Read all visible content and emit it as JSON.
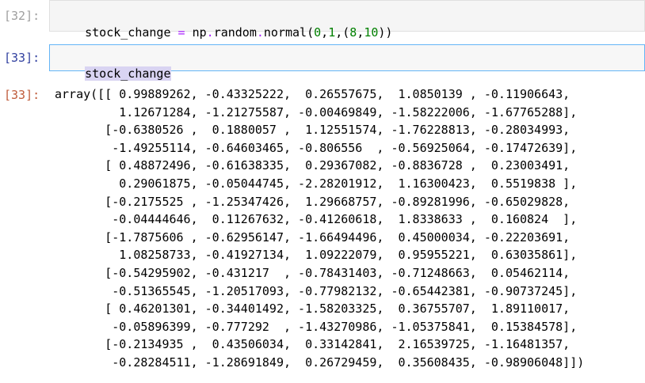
{
  "cells": [
    {
      "prompt": "[32]:",
      "code_tokens": [
        {
          "t": "stock_change",
          "k": "name"
        },
        {
          "t": " ",
          "k": "name"
        },
        {
          "t": "=",
          "k": "op"
        },
        {
          "t": " np",
          "k": "name"
        },
        {
          "t": ".",
          "k": "op"
        },
        {
          "t": "random",
          "k": "name"
        },
        {
          "t": ".",
          "k": "op"
        },
        {
          "t": "normal",
          "k": "name"
        },
        {
          "t": "(",
          "k": "paren"
        },
        {
          "t": "0",
          "k": "num"
        },
        {
          "t": ",",
          "k": "paren"
        },
        {
          "t": "1",
          "k": "num"
        },
        {
          "t": ",(",
          "k": "paren"
        },
        {
          "t": "8",
          "k": "num"
        },
        {
          "t": ",",
          "k": "paren"
        },
        {
          "t": "10",
          "k": "num"
        },
        {
          "t": "))",
          "k": "paren"
        }
      ]
    },
    {
      "prompt": "[33]:",
      "code": "stock_change"
    }
  ],
  "output": {
    "prompt": "[33]:",
    "lines": [
      "array([[ 0.99889262, -0.43325222,  0.26557675,  1.0850139 , -0.11906643,",
      "         1.12671284, -1.21275587, -0.00469849, -1.58222006, -1.67765288],",
      "       [-0.6380526 ,  0.1880057 ,  1.12551574, -1.76228813, -0.28034993,",
      "        -1.49255114, -0.64603465, -0.806556  , -0.56925064, -0.17472639],",
      "       [ 0.48872496, -0.61638335,  0.29367082, -0.8836728 ,  0.23003491,",
      "         0.29061875, -0.05044745, -2.28201912,  1.16300423,  0.5519838 ],",
      "       [-0.2175525 , -1.25347426,  1.29668757, -0.89281996, -0.65029828,",
      "        -0.04444646,  0.11267632, -0.41260618,  1.8338633 ,  0.160824  ],",
      "       [-1.7875606 , -0.62956147, -1.66494496,  0.45000034, -0.22203691,",
      "         1.08258733, -0.41927134,  1.09222079,  0.95955221,  0.63035861],",
      "       [-0.54295902, -0.431217  , -0.78431403, -0.71248663,  0.05462114,",
      "        -0.51365545, -1.20517093, -0.77982132, -0.65442381, -0.90737245],",
      "       [ 0.46201301, -0.34401492, -1.58203325,  0.36755707,  1.89110017,",
      "        -0.05896399, -0.777292  , -1.43270986, -1.05375841,  0.15384578],",
      "       [-0.2134935 ,  0.43506034,  0.33142841,  2.16539725, -1.16481357,",
      "        -0.28284511, -1.28691849,  0.26729459,  0.35608435, -0.98906048]])"
    ]
  }
}
